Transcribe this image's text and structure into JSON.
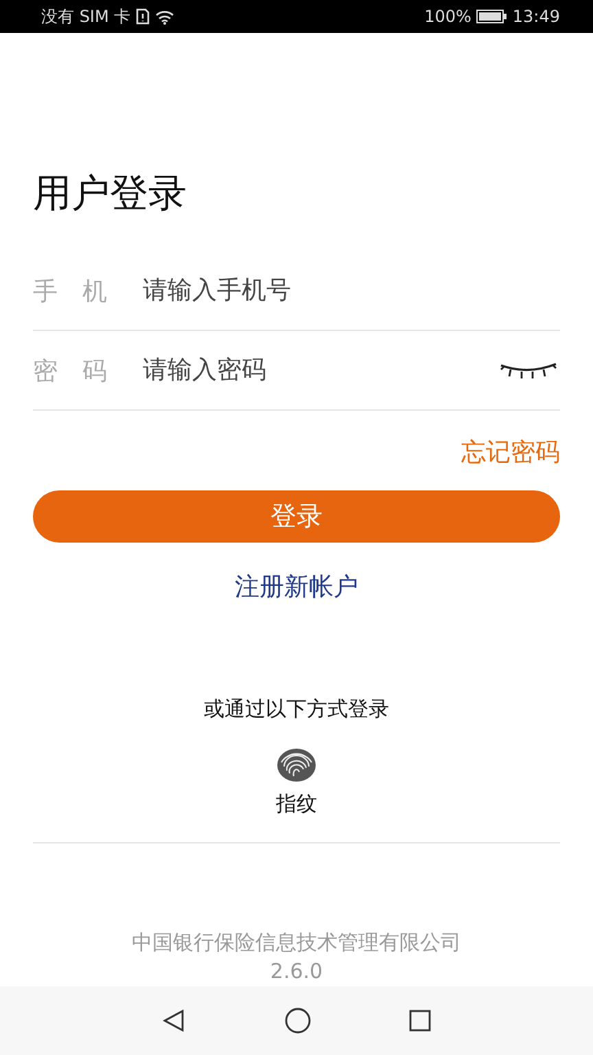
{
  "status_bar": {
    "carrier": "没有 SIM 卡",
    "battery": "100%",
    "time": "13:49"
  },
  "title": "用户登录",
  "fields": [
    {
      "label": "手　机",
      "placeholder": "请输入手机号",
      "kind": "text"
    },
    {
      "label": "密　码",
      "placeholder": "请输入密码",
      "kind": "password"
    }
  ],
  "forgot_link": "忘记密码",
  "login_button": "登录",
  "register_link": "注册新帐户",
  "alt_login": {
    "heading": "或通过以下方式登录",
    "methods": [
      {
        "label": "指纹"
      }
    ]
  },
  "footer": {
    "company": "中国银行保险信息技术管理有限公司",
    "version": "2.6.0"
  }
}
